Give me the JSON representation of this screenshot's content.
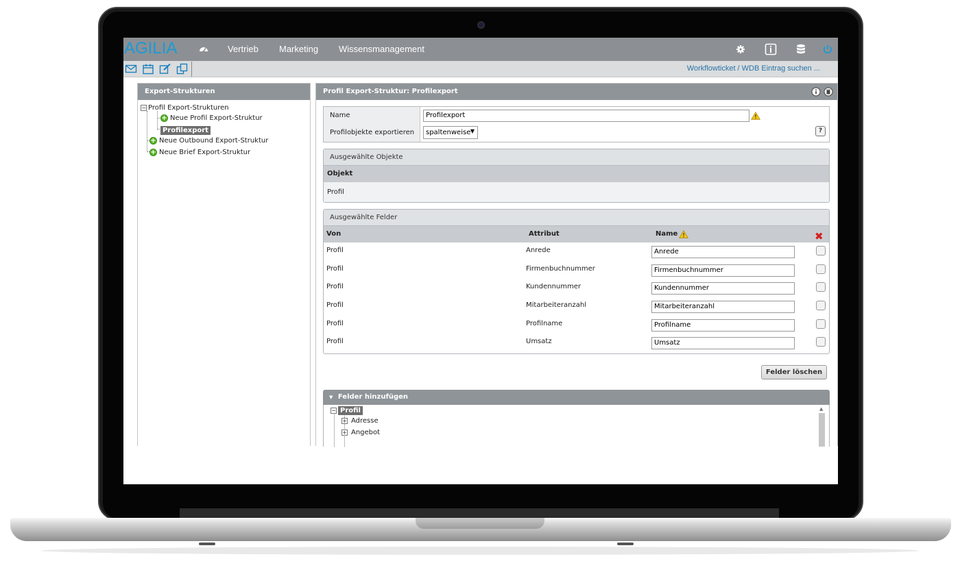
{
  "app": {
    "logo": "AGILIA",
    "nav": [
      "Vertrieb",
      "Marketing",
      "Wissensmanagement"
    ],
    "top_icons": [
      "gear-icon",
      "info-icon",
      "database-icon",
      "power-icon"
    ],
    "brand_color": "#1b9ad6"
  },
  "toolbar": {
    "icons": [
      "mail-icon",
      "calendar-icon",
      "edit-icon",
      "copy-icon"
    ],
    "search_link": "Workflowticket / WDB Eintrag suchen ..."
  },
  "left_panel": {
    "title": "Export-Strukturen",
    "tree": {
      "root": "Profil Export-Strukturen",
      "child_new": "Neue Profil Export-Struktur",
      "child_selected": "Profilexport",
      "outbound": "Neue Outbound Export-Struktur",
      "brief": "Neue Brief Export-Struktur"
    }
  },
  "right_panel": {
    "title": "Profil Export-Struktur: Profilexport",
    "form": {
      "name_label": "Name",
      "name_value": "Profilexport",
      "export_label": "Profilobjekte exportieren",
      "export_value": "spaltenweise",
      "help": "?"
    },
    "objects": {
      "title": "Ausgewählte Objekte",
      "header": "Objekt",
      "rows": [
        "Profil"
      ]
    },
    "fields": {
      "title": "Ausgewählte Felder",
      "headers": {
        "von": "Von",
        "attribut": "Attribut",
        "name": "Name"
      },
      "rows": [
        {
          "von": "Profil",
          "attribut": "Anrede",
          "name": "Anrede"
        },
        {
          "von": "Profil",
          "attribut": "Firmenbuchnummer",
          "name": "Firmenbuchnummer"
        },
        {
          "von": "Profil",
          "attribut": "Kundennummer",
          "name": "Kundennummer"
        },
        {
          "von": "Profil",
          "attribut": "Mitarbeiteranzahl",
          "name": "Mitarbeiteranzahl"
        },
        {
          "von": "Profil",
          "attribut": "Profilname",
          "name": "Profilname"
        },
        {
          "von": "Profil",
          "attribut": "Umsatz",
          "name": "Umsatz"
        }
      ]
    },
    "clear_button": "Felder löschen",
    "add_fields": {
      "title": "Felder hinzufügen",
      "tree_root": "Profil",
      "tree_items": [
        "Adresse",
        "Angebot"
      ]
    }
  }
}
